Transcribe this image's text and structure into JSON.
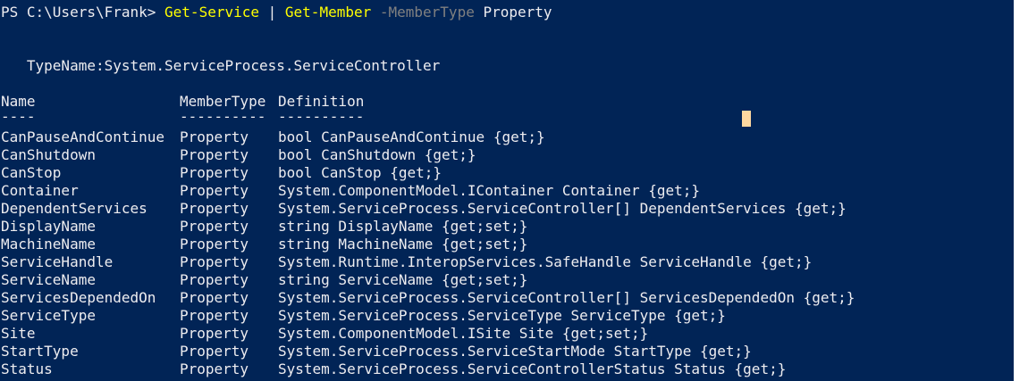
{
  "terminal": {
    "background": "#012456",
    "foreground": "#eeedf0",
    "prompt_tokens": [
      {
        "text": "PS C:\\Users\\Frank> ",
        "color": "default"
      },
      {
        "text": "Get-Service",
        "color": "cmd"
      },
      {
        "text": " | ",
        "color": "default"
      },
      {
        "text": "Get-Member",
        "color": "cmd"
      },
      {
        "text": " -MemberType",
        "color": "param"
      },
      {
        "text": " Property",
        "color": "default"
      }
    ],
    "typename_line": "   TypeName:System.ServiceProcess.ServiceController",
    "headers": {
      "name": "Name",
      "membertype": "MemberType",
      "definition": "Definition"
    },
    "underlines": {
      "name": "----",
      "membertype": "----------",
      "definition": "----------"
    },
    "rows": [
      {
        "name": "CanPauseAndContinue",
        "membertype": "Property",
        "definition": "bool CanPauseAndContinue {get;}"
      },
      {
        "name": "CanShutdown",
        "membertype": "Property",
        "definition": "bool CanShutdown {get;}"
      },
      {
        "name": "CanStop",
        "membertype": "Property",
        "definition": "bool CanStop {get;}"
      },
      {
        "name": "Container",
        "membertype": "Property",
        "definition": "System.ComponentModel.IContainer Container {get;}"
      },
      {
        "name": "DependentServices",
        "membertype": "Property",
        "definition": "System.ServiceProcess.ServiceController[] DependentServices {get;}"
      },
      {
        "name": "DisplayName",
        "membertype": "Property",
        "definition": "string DisplayName {get;set;}"
      },
      {
        "name": "MachineName",
        "membertype": "Property",
        "definition": "string MachineName {get;set;}"
      },
      {
        "name": "ServiceHandle",
        "membertype": "Property",
        "definition": "System.Runtime.InteropServices.SafeHandle ServiceHandle {get;}"
      },
      {
        "name": "ServiceName",
        "membertype": "Property",
        "definition": "string ServiceName {get;set;}"
      },
      {
        "name": "ServicesDependedOn",
        "membertype": "Property",
        "definition": "System.ServiceProcess.ServiceController[] ServicesDependedOn {get;}"
      },
      {
        "name": "ServiceType",
        "membertype": "Property",
        "definition": "System.ServiceProcess.ServiceType ServiceType {get;}"
      },
      {
        "name": "Site",
        "membertype": "Property",
        "definition": "System.ComponentModel.ISite Site {get;set;}"
      },
      {
        "name": "StartType",
        "membertype": "Property",
        "definition": "System.ServiceProcess.ServiceStartMode StartType {get;}"
      },
      {
        "name": "Status",
        "membertype": "Property",
        "definition": "System.ServiceProcess.ServiceControllerStatus Status {get;}"
      }
    ],
    "colors": {
      "cmd": "#ffff00",
      "param": "#808080",
      "default": "#eeedf0",
      "cursor": "#fed8a0"
    }
  }
}
